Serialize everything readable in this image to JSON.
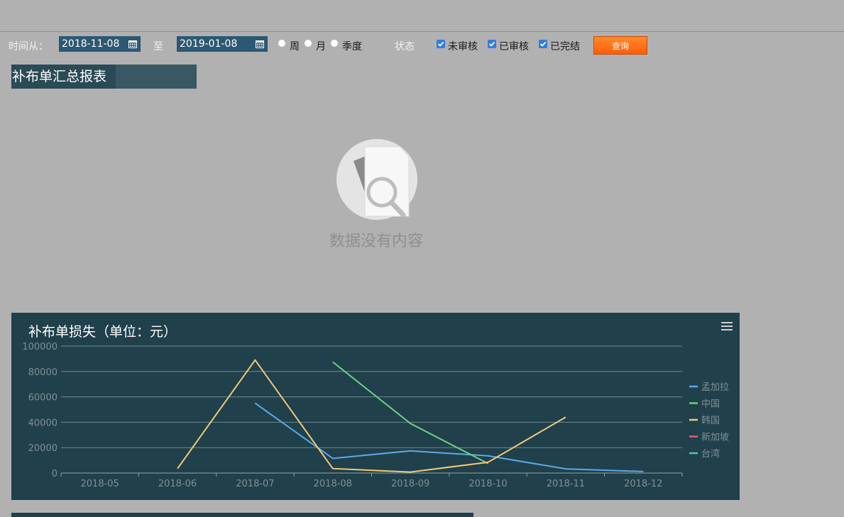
{
  "filter": {
    "from_label": "时间从：",
    "start_date": "2018-11-08",
    "to_label": "至",
    "end_date": "2019-01-08",
    "period_options": [
      "周",
      "月",
      "季度"
    ],
    "status_label": "状态",
    "status_options": [
      "未审核",
      "已审核",
      "已完结"
    ],
    "query_button": "查询"
  },
  "summary": {
    "title": "补布单汇总报表",
    "empty_text": "数据没有内容"
  },
  "chart_data": {
    "type": "line",
    "title": "补布单损失（单位：元）",
    "categories": [
      "2018-05",
      "2018-06",
      "2018-07",
      "2018-08",
      "2018-09",
      "2018-10",
      "2018-11",
      "2018-12"
    ],
    "ylim": [
      0,
      100000
    ],
    "yticks": [
      "0",
      "20000",
      "40000",
      "60000",
      "80000",
      "100000"
    ],
    "grid": true,
    "legend_position": "right",
    "series": [
      {
        "name": "孟加拉",
        "color": "#5aa9ea",
        "values": [
          null,
          null,
          55000,
          11500,
          17500,
          13500,
          3300,
          1200
        ]
      },
      {
        "name": "中国",
        "color": "#6fd17f",
        "values": [
          null,
          null,
          null,
          87500,
          39000,
          7500,
          null,
          null
        ]
      },
      {
        "name": "韩国",
        "color": "#f2c978",
        "values": [
          null,
          3500,
          89000,
          3500,
          800,
          8500,
          44000,
          null
        ]
      },
      {
        "name": "新加坡",
        "color": "#e0626b",
        "values": [
          null,
          null,
          null,
          null,
          null,
          null,
          null,
          null
        ]
      },
      {
        "name": "台湾",
        "color": "#4fc4b8",
        "values": [
          null,
          null,
          null,
          null,
          null,
          null,
          null,
          null
        ]
      }
    ]
  }
}
